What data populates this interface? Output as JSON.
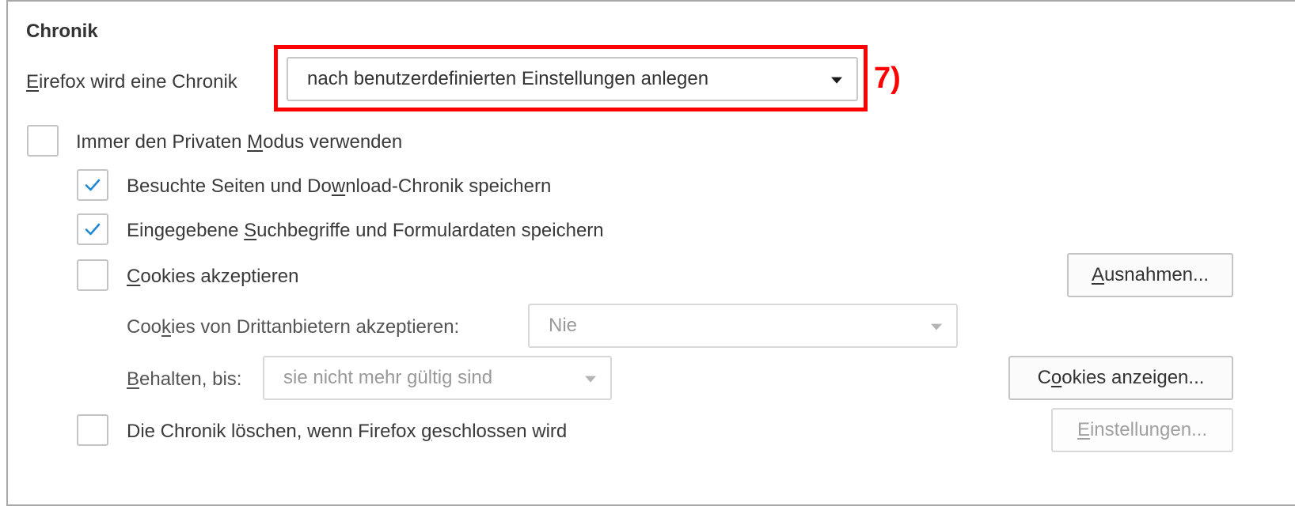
{
  "section": {
    "title": "Chronik"
  },
  "history_mode": {
    "label_prefix": "E",
    "label_rest": "irefox wird eine Chronik",
    "selected": "nach benutzerdefinierten Einstellungen anlegen"
  },
  "annotation": {
    "text": "7)"
  },
  "options": {
    "private_mode": {
      "pre": "Immer den Privaten ",
      "key": "M",
      "post": "odus verwenden",
      "checked": false
    },
    "browsing_history": {
      "pre": "Besuchte Seiten und Do",
      "key": "w",
      "post": "nload-Chronik speichern",
      "checked": true
    },
    "form_history": {
      "pre": "Eingegebene ",
      "key": "S",
      "post": "uchbegriffe und Formulardaten speichern",
      "checked": true
    },
    "accept_cookies": {
      "pre": "",
      "key": "C",
      "post": "ookies akzeptieren",
      "checked": false
    },
    "clear_on_close": {
      "pre": "Die Chronik löschen, wenn Firefox ",
      "key": "g",
      "post": "eschlossen wird",
      "checked": false
    }
  },
  "third_party": {
    "label_pre": "Coo",
    "label_key": "k",
    "label_post": "ies von Drittanbietern akzeptieren:",
    "selected": "Nie"
  },
  "keep_until": {
    "label_key": "B",
    "label_post": "ehalten, bis:",
    "selected": "sie nicht mehr gültig sind"
  },
  "buttons": {
    "exceptions": {
      "key": "A",
      "post": "usnahmen..."
    },
    "show_cookies": {
      "pre": "C",
      "key": "o",
      "post": "okies anzeigen..."
    },
    "settings": {
      "key": "E",
      "post": "instellungen..."
    }
  },
  "colors": {
    "check": "#1e88d6",
    "annotation": "#ff0000"
  }
}
